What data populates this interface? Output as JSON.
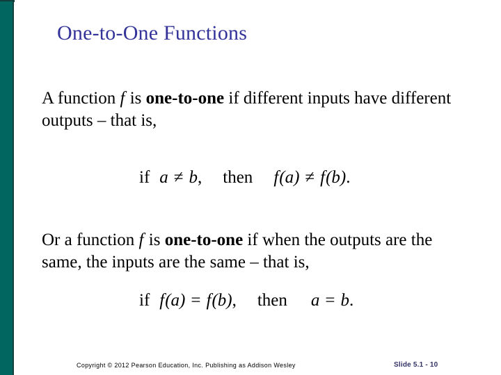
{
  "slide": {
    "title": "One-to-One Functions",
    "accent_color_side_band": "#00665f",
    "accent_color_title": "#333399",
    "background_color": "#ffffff"
  },
  "body": {
    "paragraph_1": {
      "part_1": "A function ",
      "variable_1": "f",
      "part_2": " is ",
      "emphasis": "one-to-one",
      "part_3": " if different inputs have different outputs – that is,"
    },
    "paragraph_2": {
      "part_1": "Or a function ",
      "variable_1": "f",
      "part_2": " is ",
      "emphasis": "one-to-one",
      "part_3": " if when the outputs are the same, the inputs are the same – that is,"
    }
  },
  "math": {
    "line_1": {
      "if_label": "if",
      "lhs_var_1": "a",
      "relation_1": "≠",
      "lhs_var_2": "b",
      "comma": ",",
      "then_label": "then",
      "rhs_f_1": "f",
      "rhs_arg_1": "(a)",
      "relation_2": "≠",
      "rhs_f_2": "f",
      "rhs_arg_2": "(b)",
      "period": "."
    },
    "line_2": {
      "if_label": "if",
      "lhs_f_1": "f",
      "lhs_arg_1": "(a)",
      "relation_1": "=",
      "lhs_f_2": "f",
      "lhs_arg_2": "(b)",
      "comma": ",",
      "then_label": "then",
      "rhs_var_1": "a",
      "relation_2": "=",
      "rhs_var_2": "b",
      "period": "."
    }
  },
  "footer": {
    "copyright": "Copyright © 2012 Pearson Education, Inc.  Publishing as Addison Wesley",
    "slide_number": "Slide 5.1 - 10"
  }
}
